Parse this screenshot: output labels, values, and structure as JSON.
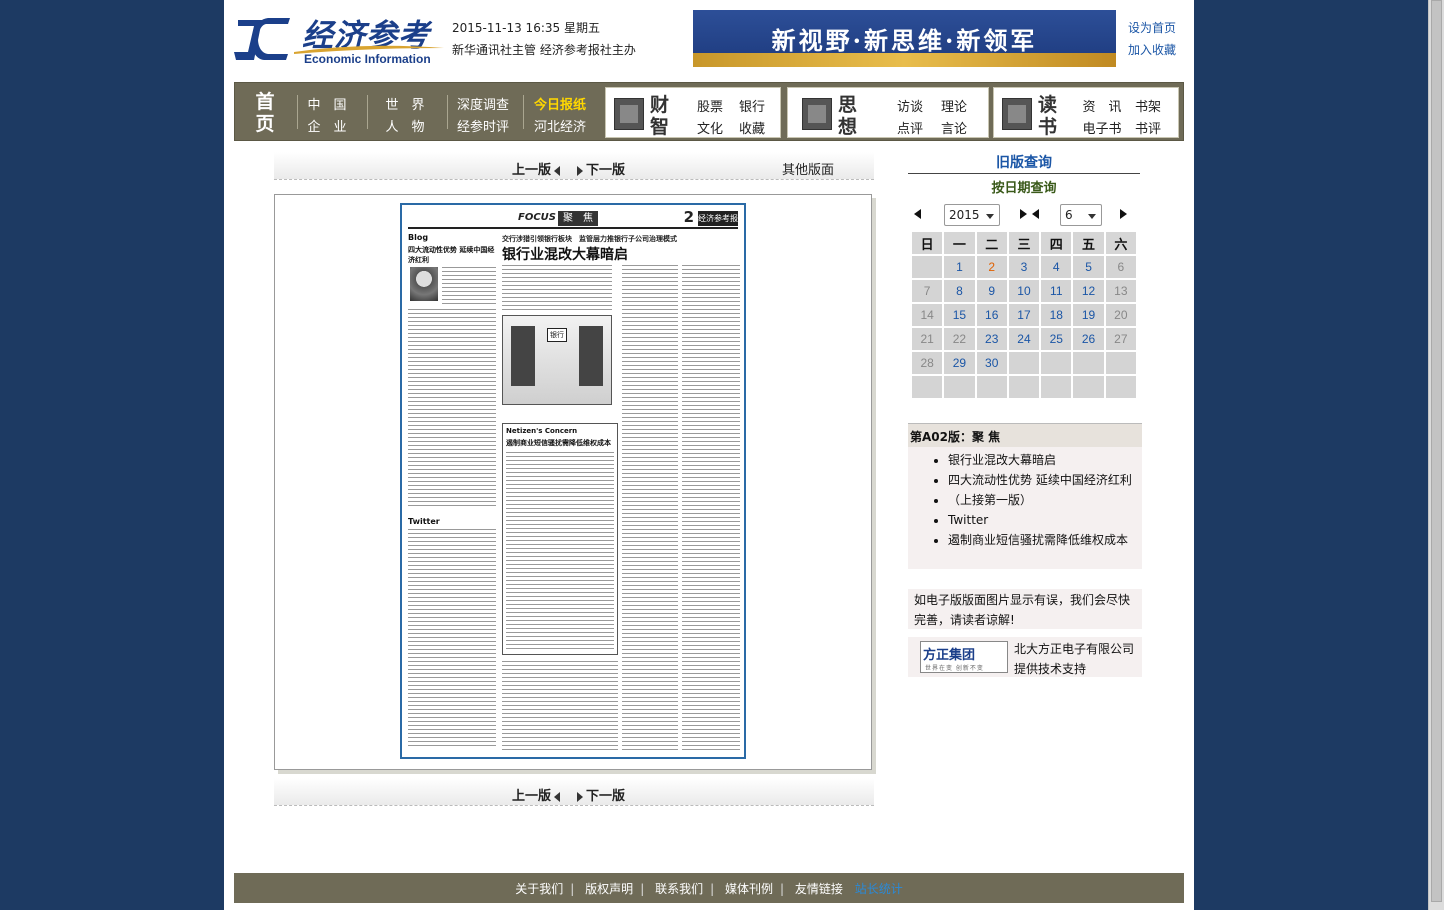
{
  "header": {
    "logo_cn": "经济参考",
    "logo_en": "Economic Information",
    "datetime": "2015-11-13 16:35 星期五",
    "subtitle": "新华通讯社主管 经济参考报社主办",
    "banner": "新视野·新思维·新领军",
    "set_home": "设为首页",
    "add_fav": "加入收藏"
  },
  "nav": {
    "home_top": "首",
    "home_bottom": "页",
    "row1": [
      "中　国",
      "世　界",
      "深度调查",
      "今日报纸"
    ],
    "row2": [
      "企　业",
      "人　物",
      "经参时评",
      "河北经济"
    ],
    "caizhi": {
      "t1": "财",
      "t2": "智",
      "links": [
        [
          "股票",
          "银行"
        ],
        [
          "文化",
          "收藏"
        ]
      ]
    },
    "sixiang": {
      "t1": "思",
      "t2": "想",
      "links": [
        [
          "访谈",
          "理论"
        ],
        [
          "点评",
          "言论"
        ]
      ]
    },
    "dushu": {
      "t1": "读",
      "t2": "书",
      "links": [
        [
          "资　讯",
          "书架"
        ],
        [
          "电子书",
          "书评"
        ]
      ]
    }
  },
  "paging": {
    "prev": "上一版",
    "next": "下一版",
    "other": "其他版面"
  },
  "paper": {
    "focus": "FOCUS",
    "section": "聚　焦",
    "page_no": "2",
    "brand": "经济参考报",
    "kicker": "交行涉猎引领银行板块　监管层力推银行子公司治理模式",
    "headline": "银行业混改大幕暗启",
    "blog": "Blog",
    "side_title": "四大流动性优势 延续中国经济红利",
    "concern": "Netizen's Concern",
    "concern_title": "遏制商业短信骚扰需降低维权成本",
    "twitter": "Twitter",
    "bank_label": "银行"
  },
  "calendar": {
    "old_query": "旧版查询",
    "by_date": "按日期查询",
    "year": "2015",
    "month": "6",
    "weekdays": [
      "日",
      "一",
      "二",
      "三",
      "四",
      "五",
      "六"
    ],
    "weeks": [
      [
        "",
        "1",
        "2",
        "3",
        "4",
        "5",
        "6"
      ],
      [
        "7",
        "8",
        "9",
        "10",
        "11",
        "12",
        "13"
      ],
      [
        "14",
        "15",
        "16",
        "17",
        "18",
        "19",
        "20"
      ],
      [
        "21",
        "22",
        "23",
        "24",
        "25",
        "26",
        "27"
      ],
      [
        "28",
        "29",
        "30",
        "",
        "",
        "",
        ""
      ],
      [
        "",
        "",
        "",
        "",
        "",
        "",
        ""
      ]
    ]
  },
  "edition": {
    "heading": "第A02版：聚 焦",
    "articles": [
      "银行业混改大幕暗启",
      "四大流动性优势 延续中国经济红利",
      "（上接第一版）",
      "Twitter",
      "遏制商业短信骚扰需降低维权成本"
    ]
  },
  "notice": "如电子版版面图片显示有误，我们会尽快完善，请读者谅解!",
  "support": {
    "logo": "方正集团",
    "logo_sub": "世界在变 创新不变",
    "line1": "北大方正电子有限公司",
    "line2": "提供技术支持"
  },
  "footer": {
    "links": [
      "关于我们",
      "版权声明",
      "联系我们",
      "媒体刊例",
      "友情链接"
    ],
    "stats": "站长统计"
  },
  "colors": {
    "nav_bg": "#6f6b57",
    "link": "#1b56a6",
    "highlight": "#ffd700",
    "bg": "#1d3a63"
  }
}
